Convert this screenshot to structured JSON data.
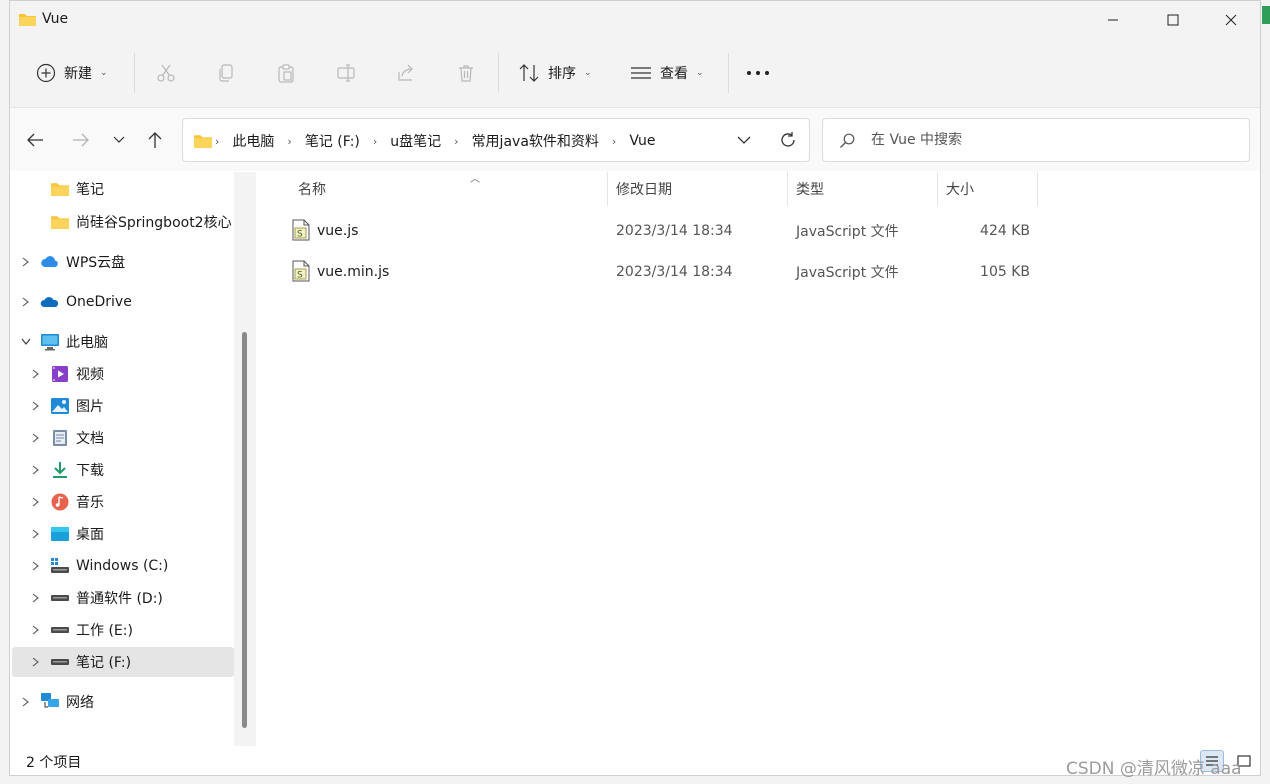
{
  "window": {
    "title": "Vue"
  },
  "commands": {
    "new_label": "新建",
    "sort_label": "排序",
    "view_label": "查看"
  },
  "navigation": {
    "breadcrumbs": [
      "此电脑",
      "笔记 (F:)",
      "u盘笔记",
      "常用java软件和资料",
      "Vue"
    ],
    "search_placeholder": "在 Vue 中搜索"
  },
  "sidebar": {
    "items": [
      {
        "label": "笔记",
        "icon": "folder-icon"
      },
      {
        "label": "尚硅谷Springboot2核心",
        "icon": "folder-icon"
      },
      {
        "label": "WPS云盘",
        "icon": "wps-cloud-icon"
      },
      {
        "label": "OneDrive",
        "icon": "onedrive-icon"
      },
      {
        "label": "此电脑",
        "icon": "this-pc-icon"
      },
      {
        "label": "视频",
        "icon": "videos-icon"
      },
      {
        "label": "图片",
        "icon": "pictures-icon"
      },
      {
        "label": "文档",
        "icon": "documents-icon"
      },
      {
        "label": "下载",
        "icon": "downloads-icon"
      },
      {
        "label": "音乐",
        "icon": "music-icon"
      },
      {
        "label": "桌面",
        "icon": "desktop-icon"
      },
      {
        "label": "Windows (C:)",
        "icon": "system-drive-icon"
      },
      {
        "label": "普通软件 (D:)",
        "icon": "drive-icon"
      },
      {
        "label": "工作 (E:)",
        "icon": "drive-icon"
      },
      {
        "label": "笔记 (F:)",
        "icon": "drive-icon",
        "selected": true
      },
      {
        "label": "网络",
        "icon": "network-icon"
      }
    ]
  },
  "file_list": {
    "columns": {
      "name": "名称",
      "date": "修改日期",
      "type": "类型",
      "size": "大小"
    },
    "files": [
      {
        "name": "vue.js",
        "date": "2023/3/14 18:34",
        "type": "JavaScript 文件",
        "size": "424 KB",
        "icon": "js-file-icon"
      },
      {
        "name": "vue.min.js",
        "date": "2023/3/14 18:34",
        "type": "JavaScript 文件",
        "size": "105 KB",
        "icon": "js-file-icon"
      }
    ]
  },
  "status": {
    "item_count": "2 个项目"
  },
  "watermark": "CSDN @清风微凉 aaa",
  "colors": {
    "accent": "#0067c0",
    "folder": "#f8c43c",
    "selection": "#e5e5e5"
  }
}
